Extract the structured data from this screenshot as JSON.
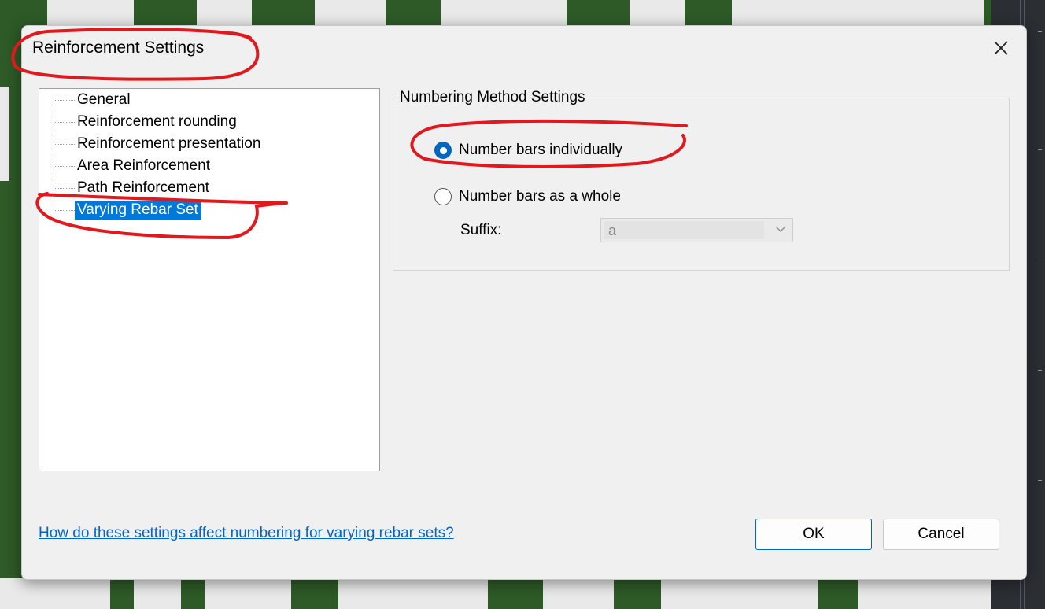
{
  "dialog": {
    "title": "Reinforcement Settings"
  },
  "tree": {
    "items": [
      {
        "label": "General"
      },
      {
        "label": "Reinforcement rounding"
      },
      {
        "label": "Reinforcement presentation"
      },
      {
        "label": "Area Reinforcement"
      },
      {
        "label": "Path Reinforcement"
      },
      {
        "label": "Varying Rebar Set",
        "selected": true
      }
    ]
  },
  "numbering": {
    "group_title": "Numbering Method Settings",
    "options": [
      {
        "label": "Number bars individually",
        "checked": true
      },
      {
        "label": "Number bars as a whole",
        "checked": false
      }
    ],
    "suffix_label": "Suffix:",
    "suffix_value": "a"
  },
  "footer": {
    "help_link": "How do these settings affect numbering for varying rebar sets?",
    "ok_label": "OK",
    "cancel_label": "Cancel"
  },
  "colors": {
    "accent": "#0067c0",
    "selection": "#0078d7",
    "annotation": "#e0191f",
    "link": "#0066cc"
  },
  "icons": [
    "close-icon",
    "chevron-down-icon"
  ]
}
